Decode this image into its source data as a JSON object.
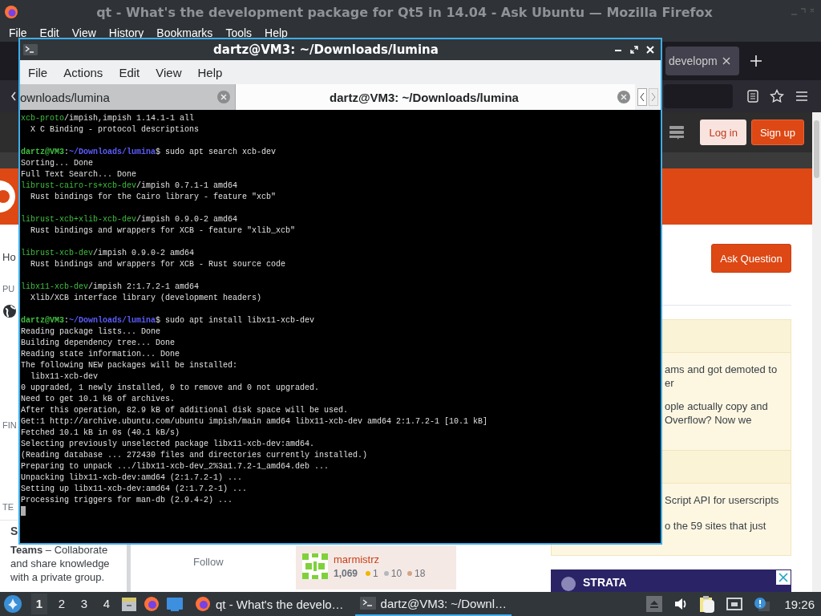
{
  "browser": {
    "title": "qt - What's the development package for Qt5 in 14.04 - Ask Ubuntu — Mozilla Firefox",
    "menu": [
      "File",
      "Edit",
      "View",
      "History",
      "Bookmarks",
      "Tools",
      "Help"
    ],
    "tab": {
      "label": "developm"
    },
    "page": {
      "header_buttons": [
        {
          "label": "Log in",
          "kind": "secondary"
        },
        {
          "label": "Sign up",
          "kind": "primary"
        }
      ],
      "left_nav": {
        "top": [
          "Ho",
          "PU"
        ],
        "bottom": [
          "FIN",
          "TE"
        ]
      },
      "teams_teaser": {
        "heading": "S",
        "text": "**Teams** – Collaborate and share knowledge with a private group."
      },
      "follow": "Follow",
      "user_card": {
        "name": "marmistrz",
        "reputation": "1,069",
        "badges": [
          {
            "count": "1",
            "color": "#f1b600"
          },
          {
            "count": "10",
            "color": "#b4b8bc"
          },
          {
            "count": "18",
            "color": "#d1a684"
          }
        ]
      },
      "ask_button": "Ask Question",
      "sidebar_sections": [
        {
          "items": [
            {
              "lines": [
                "ams and got demoted to",
                "er"
              ]
            },
            {
              "lines": [
                "ople actually copy and",
                "Overflow? Now we"
              ]
            }
          ]
        },
        {
          "items": [
            {
              "lines": [
                "Script API for userscripts"
              ]
            },
            {
              "lines": [
                "o the 59 sites that just"
              ]
            }
          ]
        }
      ],
      "ad": {
        "brand": "STRATA"
      }
    }
  },
  "terminal": {
    "title": "dartz@VM3: ~/Downloads/lumina",
    "menu": [
      "File",
      "Actions",
      "Edit",
      "View",
      "Help"
    ],
    "tabs": [
      {
        "label": "ownloads/lumina",
        "selected": false
      },
      {
        "label": "dartz@VM3: ~/Downloads/lumina",
        "selected": true
      }
    ],
    "lines": [
      {
        "kind": "colored",
        "segments": [
          {
            "kind": "pkg",
            "text": "xcb-proto"
          },
          {
            "kind": "plain",
            "text": "/impish,impish 1.14.1-1 all"
          }
        ]
      },
      {
        "kind": "output",
        "text": "  X C Binding - protocol descriptions"
      },
      {
        "kind": "blank"
      },
      {
        "kind": "colored",
        "segments": [
          {
            "kind": "user",
            "text": "dartz@VM3"
          },
          {
            "kind": "plain",
            "text": ":"
          },
          {
            "kind": "path",
            "text": "~/Downloads/lumina"
          },
          {
            "kind": "plain",
            "text": "$ sudo apt search xcb-dev"
          }
        ]
      },
      {
        "kind": "output",
        "text": "Sorting... Done"
      },
      {
        "kind": "output",
        "text": "Full Text Search... Done"
      },
      {
        "kind": "colored",
        "segments": [
          {
            "kind": "pkg",
            "text": "librust-cairo-rs+xcb-dev"
          },
          {
            "kind": "plain",
            "text": "/impish 0.7.1-1 amd64"
          }
        ]
      },
      {
        "kind": "output",
        "text": "  Rust bindings for the Cairo library - feature \"xcb\""
      },
      {
        "kind": "blank"
      },
      {
        "kind": "colored",
        "segments": [
          {
            "kind": "pkg",
            "text": "librust-xcb+xlib-xcb-dev"
          },
          {
            "kind": "plain",
            "text": "/impish 0.9.0-2 amd64"
          }
        ]
      },
      {
        "kind": "output",
        "text": "  Rust bindings and wrappers for XCB - feature \"xlib_xcb\""
      },
      {
        "kind": "blank"
      },
      {
        "kind": "colored",
        "segments": [
          {
            "kind": "pkg",
            "text": "librust-xcb-dev"
          },
          {
            "kind": "plain",
            "text": "/impish 0.9.0-2 amd64"
          }
        ]
      },
      {
        "kind": "output",
        "text": "  Rust bindings and wrappers for XCB - Rust source code"
      },
      {
        "kind": "blank"
      },
      {
        "kind": "colored",
        "segments": [
          {
            "kind": "pkg",
            "text": "libx11-xcb-dev"
          },
          {
            "kind": "plain",
            "text": "/impish 2:1.7.2-1 amd64"
          }
        ]
      },
      {
        "kind": "output",
        "text": "  Xlib/XCB interface library (development headers)"
      },
      {
        "kind": "blank"
      },
      {
        "kind": "colored",
        "segments": [
          {
            "kind": "user",
            "text": "dartz@VM3"
          },
          {
            "kind": "plain",
            "text": ":"
          },
          {
            "kind": "path",
            "text": "~/Downloads/lumina"
          },
          {
            "kind": "plain",
            "text": "$ sudo apt install libx11-xcb-dev"
          }
        ]
      },
      {
        "kind": "output",
        "text": "Reading package lists... Done"
      },
      {
        "kind": "output",
        "text": "Building dependency tree... Done"
      },
      {
        "kind": "output",
        "text": "Reading state information... Done"
      },
      {
        "kind": "output",
        "text": "The following NEW packages will be installed:"
      },
      {
        "kind": "output",
        "text": "  libx11-xcb-dev"
      },
      {
        "kind": "output",
        "text": "0 upgraded, 1 newly installed, 0 to remove and 0 not upgraded."
      },
      {
        "kind": "output",
        "text": "Need to get 10.1 kB of archives."
      },
      {
        "kind": "output",
        "text": "After this operation, 82.9 kB of additional disk space will be used."
      },
      {
        "kind": "output",
        "text": "Get:1 http://archive.ubuntu.com/ubuntu impish/main amd64 libx11-xcb-dev amd64 2:1.7.2-1 [10.1 kB]"
      },
      {
        "kind": "output",
        "text": "Fetched 10.1 kB in 0s (40.1 kB/s)"
      },
      {
        "kind": "output",
        "text": "Selecting previously unselected package libx11-xcb-dev:amd64."
      },
      {
        "kind": "output",
        "text": "(Reading database ... 272430 files and directories currently installed.)"
      },
      {
        "kind": "output",
        "text": "Preparing to unpack .../libx11-xcb-dev_2%3a1.7.2-1_amd64.deb ..."
      },
      {
        "kind": "output",
        "text": "Unpacking libx11-xcb-dev:amd64 (2:1.7.2-1) ..."
      },
      {
        "kind": "output",
        "text": "Setting up libx11-xcb-dev:amd64 (2:1.7.2-1) ..."
      },
      {
        "kind": "output",
        "text": "Processing triggers for man-db (2.9.4-2) ..."
      },
      {
        "kind": "cursor"
      }
    ]
  },
  "taskbar": {
    "workspaces": [
      {
        "label": "1",
        "selected": true
      },
      {
        "label": "2",
        "selected": false
      },
      {
        "label": "3",
        "selected": false
      },
      {
        "label": "4",
        "selected": false
      }
    ],
    "tasks": [
      {
        "label": "qt - What's the develo…",
        "kind": "browser",
        "active": false
      },
      {
        "label": "dartz@VM3: ~/Downl…",
        "kind": "terminal",
        "active": true
      }
    ],
    "clock": "19:26"
  }
}
